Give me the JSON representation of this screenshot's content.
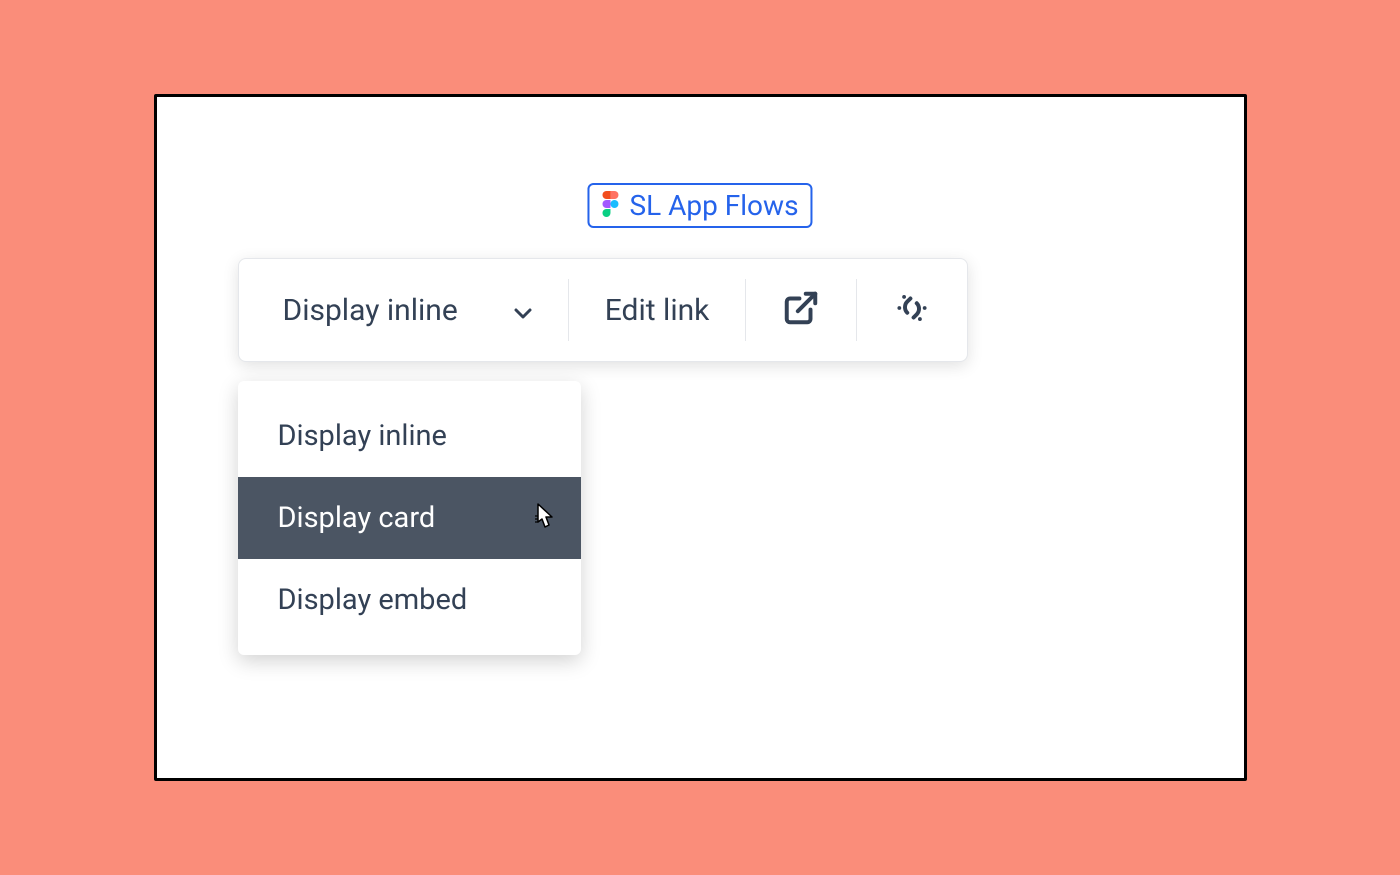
{
  "link": {
    "title": "SL App Flows",
    "icon": "figma-icon"
  },
  "toolbar": {
    "display_dropdown_label": "Display inline",
    "edit_link_label": "Edit link",
    "open_icon": "external-link-icon",
    "unlink_icon": "unlink-icon"
  },
  "dropdown": {
    "items": [
      {
        "label": "Display inline",
        "hovered": false
      },
      {
        "label": "Display card",
        "hovered": true
      },
      {
        "label": "Display embed",
        "hovered": false
      }
    ]
  },
  "colors": {
    "background": "#fa8d7a",
    "panel": "#ffffff",
    "border": "#000000",
    "link_blue": "#2563eb",
    "text_dark": "#334155",
    "hover_bg": "#4b5563"
  }
}
